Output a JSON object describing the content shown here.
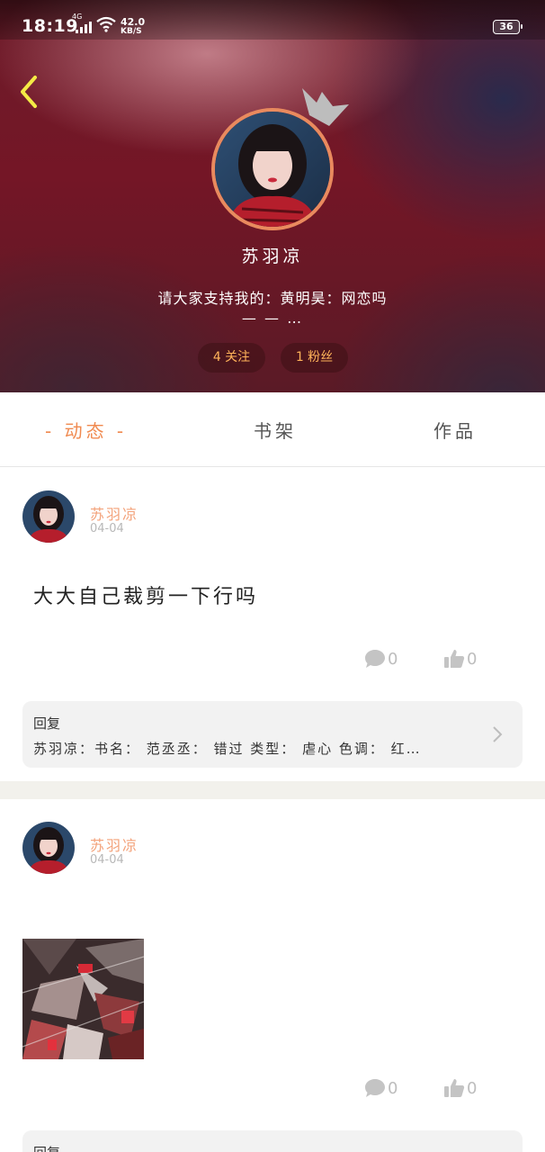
{
  "status_bar": {
    "time": "18:19",
    "network": "4G",
    "speed_value": "42.0",
    "speed_unit": "KB/S",
    "battery": "36"
  },
  "profile": {
    "name": "苏羽凉",
    "bio": "请大家支持我的：黄明昊：网恋吗",
    "bio_more": "— — …",
    "following": "4 关注",
    "fans": "1 粉丝"
  },
  "tabs": [
    {
      "label": "动态",
      "display": "- 动态 -",
      "active": true
    },
    {
      "label": "书架",
      "active": false
    },
    {
      "label": "作品",
      "active": false
    }
  ],
  "posts": [
    {
      "author": "苏羽凉",
      "date": "04-04",
      "text": "大大自己裁剪一下行吗",
      "comments": "0",
      "likes": "0",
      "reply_label": "回复",
      "reply_text": "苏羽凉：书名： 范丞丞： 错过 类型： 虐心 色调： 红…"
    },
    {
      "author": "苏羽凉",
      "date": "04-04",
      "comments": "0",
      "likes": "0",
      "reply_label": "回复"
    }
  ],
  "colors": {
    "accent": "#f08a50",
    "pill_text": "#ffb35a",
    "hero_bg": "#741626"
  }
}
